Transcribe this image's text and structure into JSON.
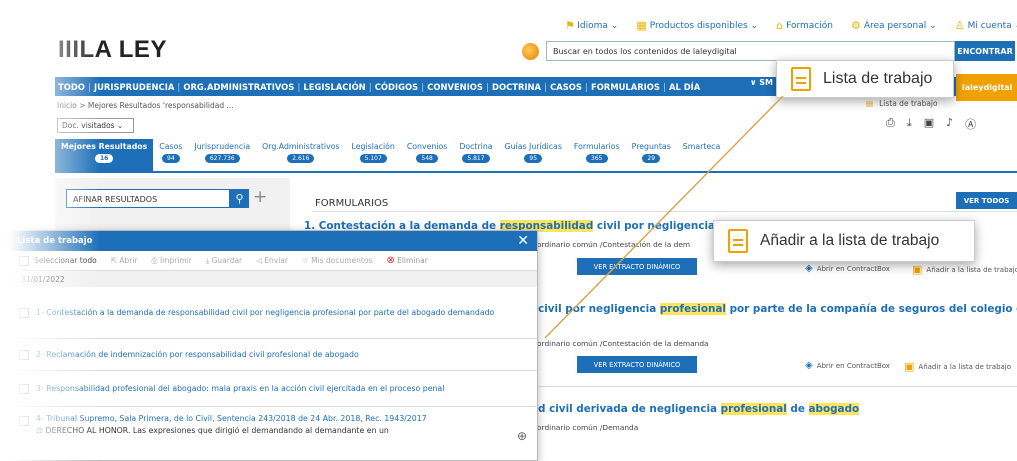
{
  "header": {
    "logo": "IIILA LEY",
    "top_nav": [
      {
        "label": "Idioma ⌄",
        "icon": "flag-icon"
      },
      {
        "label": "Productos disponibles ⌄",
        "icon": "grid-icon"
      },
      {
        "label": "Formación",
        "icon": "graduation-icon"
      },
      {
        "label": "Área personal ⌄",
        "icon": "gear-icon"
      },
      {
        "label": "Mi cuenta ⌄",
        "icon": "user-icon"
      }
    ],
    "search_placeholder": "Buscar en todos los contenidos de laleydigital",
    "search_button": "ENCONTRAR"
  },
  "main_nav": [
    "TODO",
    "JURISPRUDENCIA",
    "ORG.ADMINISTRATIVOS",
    "LEGISLACIÓN",
    "CÓDIGOS",
    "CONVENIOS",
    "DOCTRINA",
    "CASOS",
    "FORMULARIOS",
    "AL DÍA"
  ],
  "main_nav_right": "SM",
  "laley_button": "laleydigital",
  "breadcrumb": "Inicio > Mejores Resultados 'responsabilidad ...",
  "visited_select": "Doc. visitados",
  "right_link": "Lista de trabajo",
  "tabs": [
    {
      "label": "Mejores Resultados",
      "count": "16"
    },
    {
      "label": "Casos",
      "count": "94"
    },
    {
      "label": "Jurisprudencia",
      "count": "627.736"
    },
    {
      "label": "Org.Administrativos",
      "count": "2.616"
    },
    {
      "label": "Legislación",
      "count": "5.107"
    },
    {
      "label": "Convenios",
      "count": "548"
    },
    {
      "label": "Doctrina",
      "count": "5.817"
    },
    {
      "label": "Guías Jurídicas",
      "count": "95"
    },
    {
      "label": "Formularios",
      "count": "365"
    },
    {
      "label": "Preguntas",
      "count": "29"
    },
    {
      "label": "Smarteca",
      "count": ""
    }
  ],
  "refine": {
    "placeholder": "AFINAR RESULTADOS"
  },
  "results": {
    "section": "FORMULARIOS",
    "ver_todos": "VER TODOS",
    "items": [
      {
        "title_pre": "1. Contestación a la demanda de ",
        "title_hl1": "responsabilidad",
        "title_mid": " civil por negligencia ",
        "title_hl2": "profesional",
        "sub": "icio ordinario común /Contestación de la dem",
        "extract": "VER EXTRACTO DINÁMICO",
        "contract": "Abrir en ContractBox",
        "add": "Añadir a la lista de trabajo"
      },
      {
        "title_pre": "ad civil por negligencia ",
        "title_hl1": "profesional",
        "title_mid": " por parte de la compañía de seguros del colegio de",
        "sub": "icio ordinario común /Contestación de la demanda",
        "extract": "VER EXTRACTO DINÁMICO",
        "contract": "Abrir en ContractBox",
        "add": "Añadir a la lista de trabajo"
      },
      {
        "title_pre": "idad",
        "title_mid": " civil derivada de negligencia ",
        "title_hl1": "profesional",
        "title_mid2": " de ",
        "title_hl2": "abogado",
        "sub": "icio ordinario común /Demanda"
      }
    ]
  },
  "modal": {
    "title": "Lista de trabajo",
    "select_all": "Seleccionar todo",
    "tools": [
      "Abrir",
      "Imprimir",
      "Guardar",
      "Enviar",
      "Mis documentos",
      "Eliminar"
    ],
    "date": "31/01/2022",
    "items": [
      "1- Contestación a la demanda de responsabilidad civil por negligencia profesional por parte del abogado demandado",
      "2- Reclamación de indemnización por responsabilidad civil profesional de abogado",
      "3- Responsabilidad profesional del abogado: mala praxis en la acción civil ejercitada en el proceso penal",
      "4- Tribunal Supremo, Sala Primera, de lo Civil, Sentencia 243/2018 de 24 Abr. 2018, Rec. 1943/2017"
    ],
    "item4_detail": "DERECHO AL HONOR. Las expresiones que dirigió el demandando al demandante en un"
  },
  "callouts": {
    "lista": "Lista de trabajo",
    "anadir": "Añadir a la lista de trabajo"
  },
  "colors": {
    "brand_blue": "#1d6fb8",
    "accent_orange": "#f0a000",
    "highlight": "#ffe45c"
  }
}
